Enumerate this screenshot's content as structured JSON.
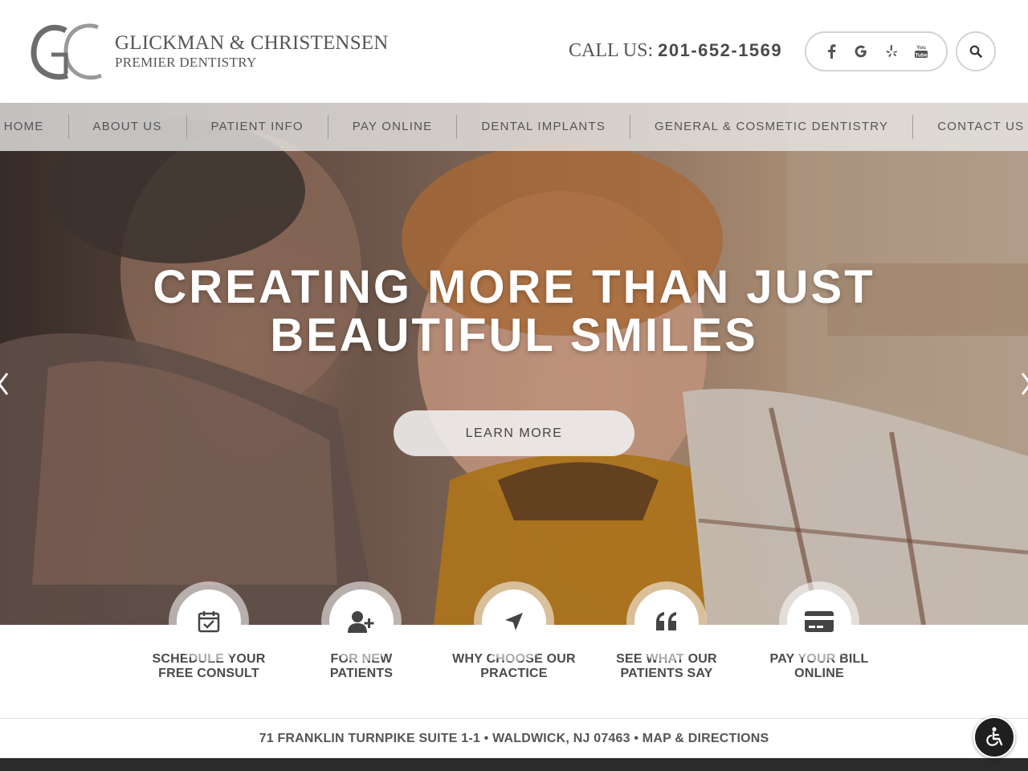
{
  "header": {
    "logo_name": "GLICKMAN & CHRISTENSEN",
    "logo_sub": "PREMIER DENTISTRY",
    "call_label": "CALL US:",
    "phone": "201-652-1569",
    "social_icons": [
      "facebook-icon",
      "google-icon",
      "yelp-icon",
      "youtube-icon"
    ],
    "youtube_text": "You Tube"
  },
  "nav": {
    "items": [
      "HOME",
      "ABOUT US",
      "PATIENT INFO",
      "PAY ONLINE",
      "DENTAL IMPLANTS",
      "GENERAL & COSMETIC DENTISTRY",
      "CONTACT US"
    ]
  },
  "hero": {
    "headline_line1": "CREATING MORE THAN JUST",
    "headline_line2": "BEAUTIFUL SMILES",
    "button_label": "LEARN MORE"
  },
  "quick_links": [
    {
      "line1": "SCHEDULE YOUR",
      "line2": "FREE CONSULT",
      "icon": "calendar-check-icon"
    },
    {
      "line1": "FOR NEW",
      "line2": "PATIENTS",
      "icon": "user-plus-icon"
    },
    {
      "line1": "WHY CHOOSE OUR",
      "line2": "PRACTICE",
      "icon": "location-arrow-icon"
    },
    {
      "line1": "SEE WHAT OUR",
      "line2": "PATIENTS SAY",
      "icon": "quote-icon"
    },
    {
      "line1": "PAY YOUR BILL",
      "line2": "ONLINE",
      "icon": "credit-card-icon"
    }
  ],
  "address": {
    "text": "71 FRANKLIN TURNPIKE SUITE 1-1 • WALDWICK, NJ 07463 • MAP & DIRECTIONS"
  },
  "colors": {
    "text": "#4a4a4a",
    "accent_dark": "#1f1f1f"
  }
}
